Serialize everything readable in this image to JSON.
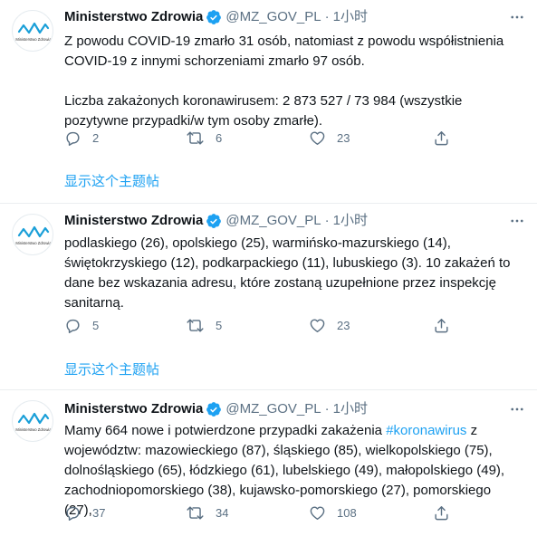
{
  "colors": {
    "link": "#1da1f2",
    "muted": "#5b7083",
    "text": "#0f1419",
    "divider": "#ebeef0"
  },
  "tweets": [
    {
      "author": {
        "name": "Ministerstwo Zdrowia",
        "handle": "@MZ_GOV_PL",
        "avatar_logo": "Ministerstwo Zdrowia"
      },
      "separator": "·",
      "time": "1小时",
      "paragraphs": [
        "Z powodu COVID-19 zmarło 31 osób, natomiast z powodu współistnienia COVID-19 z innymi schorzeniami zmarło 97 osób.",
        "Liczba zakażonych koronawirusem: 2 873 527 / 73 984 (wszystkie pozytywne przypadki/w tym osoby zmarłe)."
      ],
      "replies": "2",
      "retweets": "6",
      "likes": "23",
      "show_thread": "显示这个主题帖"
    },
    {
      "author": {
        "name": "Ministerstwo Zdrowia",
        "handle": "@MZ_GOV_PL",
        "avatar_logo": "Ministerstwo Zdrowia"
      },
      "separator": "·",
      "time": "1小时",
      "paragraphs": [
        "podlaskiego (26), opolskiego (25), warmińsko-mazurskiego (14), świętokrzyskiego (12), podkarpackiego (11), lubuskiego (3). 10 zakażeń to dane bez wskazania adresu, które zostaną uzupełnione przez inspekcję sanitarną."
      ],
      "replies": "5",
      "retweets": "5",
      "likes": "23",
      "show_thread": "显示这个主题帖"
    },
    {
      "author": {
        "name": "Ministerstwo Zdrowia",
        "handle": "@MZ_GOV_PL",
        "avatar_logo": "Ministerstwo Zdrowia"
      },
      "separator": "·",
      "time": "1小时",
      "text_before": "Mamy 664 nowe i potwierdzone przypadki zakażenia ",
      "hashtag": "#koronawirus",
      "text_after": " z województw: mazowieckiego (87), śląskiego (85), wielkopolskiego (75), dolnośląskiego (65), łódzkiego (61), lubelskiego (49), małopolskiego (49), zachodniopomorskiego (38), kujawsko-pomorskiego (27), pomorskiego (27),",
      "replies": "37",
      "retweets": "34",
      "likes": "108"
    }
  ]
}
